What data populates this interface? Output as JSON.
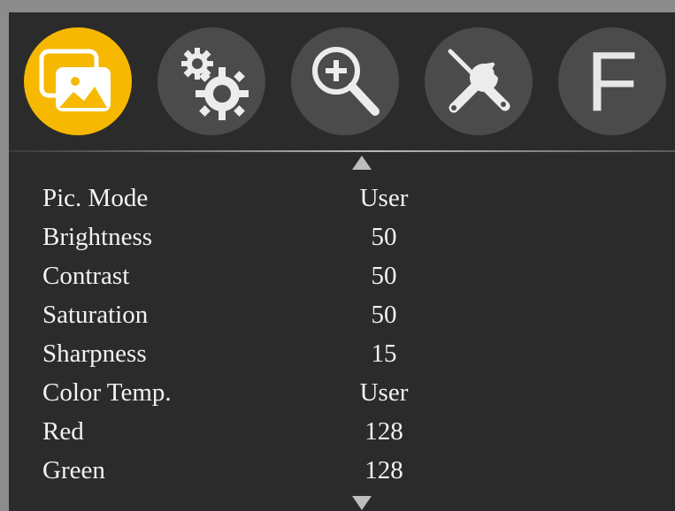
{
  "osd": {
    "tabs": [
      {
        "icon": "picture-icon",
        "active": true
      },
      {
        "icon": "gears-icon",
        "active": false
      },
      {
        "icon": "zoom-in-icon",
        "active": false
      },
      {
        "icon": "tools-icon",
        "active": false
      },
      {
        "icon": "function-icon",
        "letter": "F",
        "active": false
      }
    ],
    "accent_color": "#f6b800",
    "items": [
      {
        "label": "Pic. Mode",
        "value": "User"
      },
      {
        "label": "Brightness",
        "value": "50"
      },
      {
        "label": "Contrast",
        "value": "50"
      },
      {
        "label": "Saturation",
        "value": "50"
      },
      {
        "label": "Sharpness",
        "value": "15"
      },
      {
        "label": "Color Temp.",
        "value": "User"
      },
      {
        "label": "Red",
        "value": "128"
      },
      {
        "label": "Green",
        "value": "128"
      }
    ]
  }
}
